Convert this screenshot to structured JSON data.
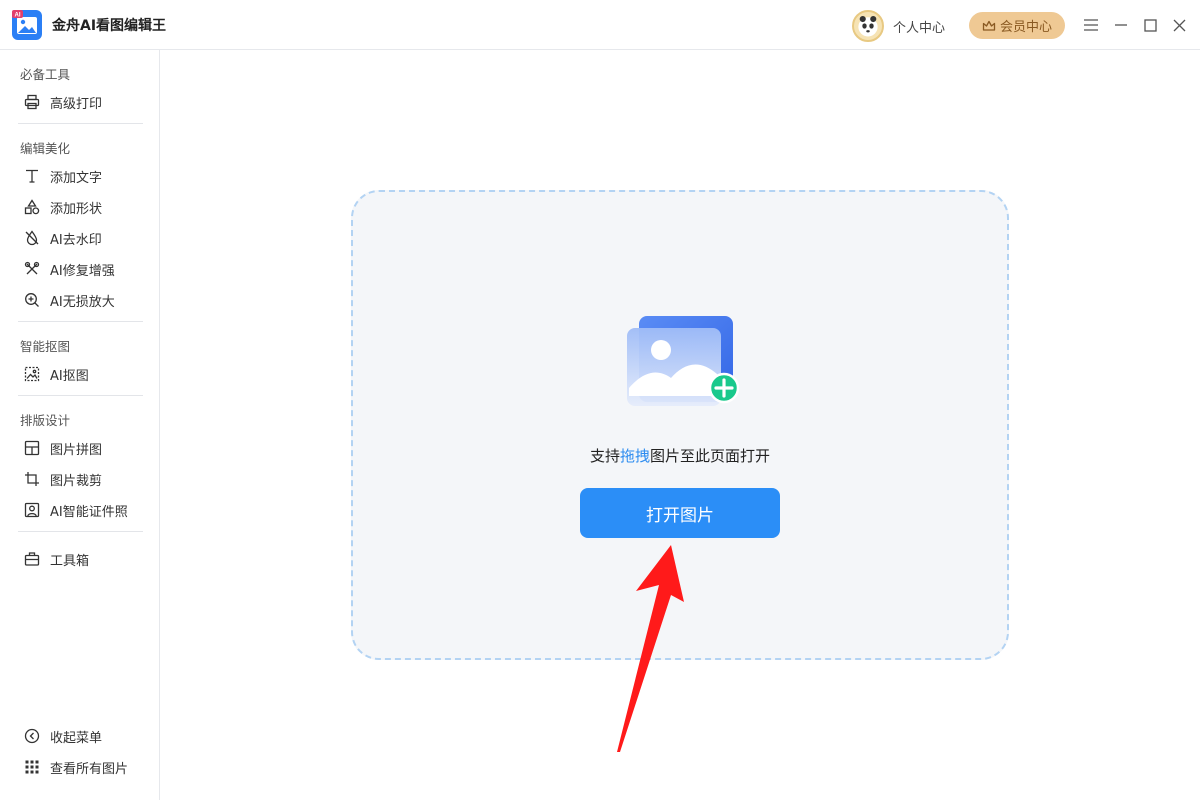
{
  "app": {
    "title": "金舟AI看图编辑王",
    "user_center": "个人中心",
    "vip_center": "会员中心"
  },
  "sidebar": {
    "sections": [
      {
        "title": "必备工具",
        "items": [
          {
            "label": "高级打印",
            "icon": "printer-icon"
          }
        ]
      },
      {
        "title": "编辑美化",
        "items": [
          {
            "label": "添加文字",
            "icon": "text-icon"
          },
          {
            "label": "添加形状",
            "icon": "shapes-icon"
          },
          {
            "label": "AI去水印",
            "icon": "watermark-icon"
          },
          {
            "label": "AI修复增强",
            "icon": "repair-icon"
          },
          {
            "label": "AI无损放大",
            "icon": "zoom-in-icon"
          }
        ]
      },
      {
        "title": "智能抠图",
        "items": [
          {
            "label": "AI抠图",
            "icon": "cutout-icon"
          }
        ]
      },
      {
        "title": "排版设计",
        "items": [
          {
            "label": "图片拼图",
            "icon": "collage-icon"
          },
          {
            "label": "图片裁剪",
            "icon": "crop-icon"
          },
          {
            "label": "AI智能证件照",
            "icon": "id-photo-icon"
          }
        ]
      }
    ],
    "toolbox": {
      "label": "工具箱",
      "icon": "toolbox-icon"
    },
    "collapse": {
      "label": "收起菜单",
      "icon": "collapse-icon"
    },
    "view_all": {
      "label": "查看所有图片",
      "icon": "grid-icon"
    }
  },
  "main": {
    "hint_prefix": "支持",
    "hint_accent": "拖拽",
    "hint_suffix": "图片至此页面打开",
    "open_button": "打开图片"
  },
  "colors": {
    "primary": "#2b8ef7",
    "accent_text": "#2d8cf0",
    "vip_bg": "#efc994",
    "plus_green": "#19c98c",
    "arrow_red": "#ff1a1a"
  }
}
